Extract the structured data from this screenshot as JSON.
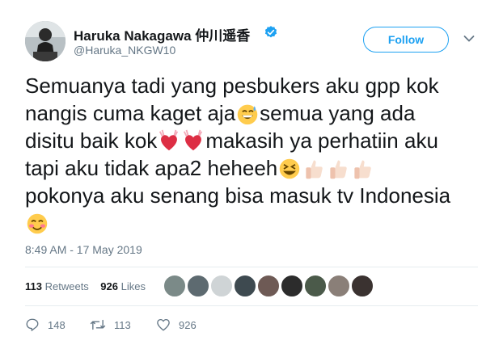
{
  "user": {
    "name": "Haruka Nakagawa 仲川遥香",
    "handle": "@Haruka_NKGW10",
    "verified": true
  },
  "follow_button": {
    "label": "Follow"
  },
  "tweet": {
    "lines": [
      [
        "Semuanya tadi yang pesbukers aku gpp kok"
      ],
      [
        "nangis cuma kaget aja",
        "semua yang ada"
      ],
      [
        "disitu baik kok",
        "makasih ya perhatiin aku"
      ],
      [
        "tapi aku tidak apa2 heheeh"
      ],
      [
        "pokonya aku senang bisa masuk tv Indonesia"
      ]
    ],
    "emojis": [
      "grinning-sweat-face",
      "heart-with-raised-hands",
      "heart-with-raised-hands",
      "laughing-face",
      "thumbs-up-light",
      "thumbs-up-light",
      "thumbs-up-light",
      "smiling-blush-face"
    ],
    "timestamp": "8:49 AM - 17 May 2019"
  },
  "stats": {
    "retweets_count": "113",
    "retweets_label": "Retweets",
    "likes_count": "926",
    "likes_label": "Likes",
    "liker_avatar_count": 9
  },
  "actions": {
    "reply_count": "148",
    "retweet_count": "113",
    "like_count": "926"
  },
  "colors": {
    "accent": "#1da1f2",
    "text": "#14171a",
    "muted": "#657786",
    "divider": "#e6ecf0"
  }
}
